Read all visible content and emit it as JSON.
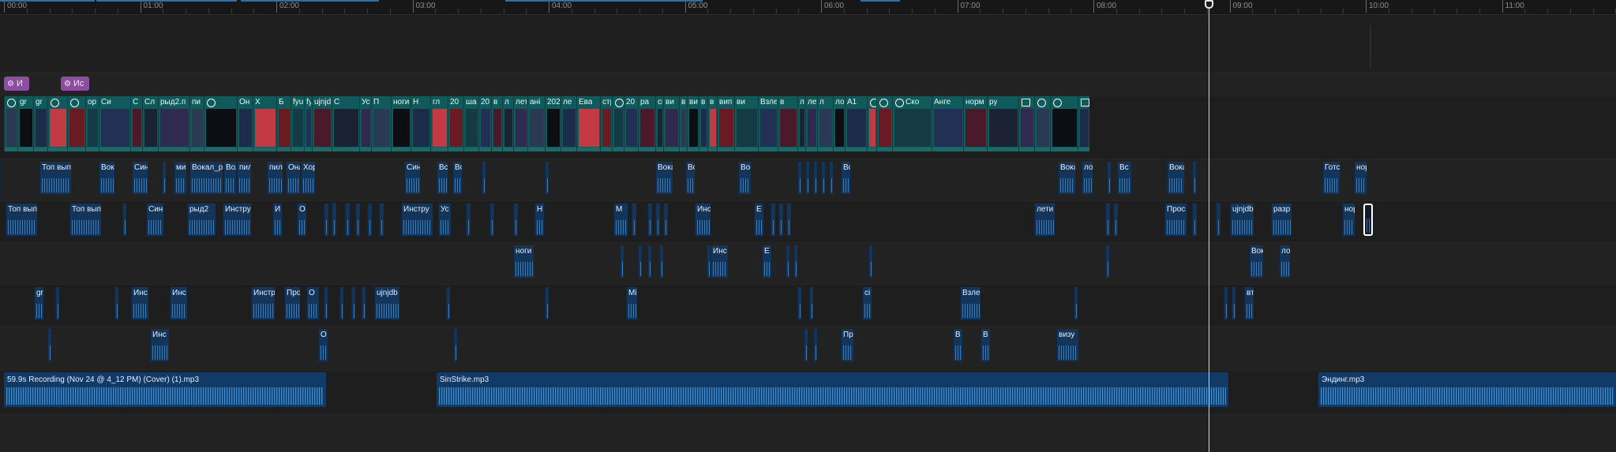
{
  "ruler": {
    "ticks": [
      "00:00",
      "01:00",
      "02:00",
      "03:00",
      "04:00",
      "05:00",
      "06:00",
      "07:00",
      "08:00",
      "09:00",
      "10:00",
      "11:00"
    ]
  },
  "playhead": {
    "time_label": ""
  },
  "tracks": {
    "effects": [
      {
        "label": "И",
        "icon": "gear-icon"
      },
      {
        "label": "Ис",
        "icon": "gear-icon"
      }
    ],
    "video": [
      {
        "label": "",
        "icon": "circle-check-icon"
      },
      {
        "label": "gr"
      },
      {
        "label": "gr"
      },
      {
        "label": "",
        "icon": "circle-check-icon"
      },
      {
        "label": "",
        "icon": "circle-check-icon"
      },
      {
        "label": "ор"
      },
      {
        "label": "Си"
      },
      {
        "label": "С"
      },
      {
        "label": "Сл"
      },
      {
        "label": "рыд2.п"
      },
      {
        "label": "пи"
      },
      {
        "label": "",
        "icon": "circle-check-icon"
      },
      {
        "label": "Он"
      },
      {
        "label": "Х"
      },
      {
        "label": "Б"
      },
      {
        "label": "fyuti"
      },
      {
        "label": "fyuti"
      },
      {
        "label": "ujnjdb"
      },
      {
        "label": "С"
      },
      {
        "label": "Ус"
      },
      {
        "label": "П"
      },
      {
        "label": "ноги"
      },
      {
        "label": "Н"
      },
      {
        "label": "гл"
      },
      {
        "label": "20"
      },
      {
        "label": "ша"
      },
      {
        "label": "20"
      },
      {
        "label": "в"
      },
      {
        "label": "л"
      },
      {
        "label": "лети"
      },
      {
        "label": "ані"
      },
      {
        "label": "202"
      },
      {
        "label": "ле"
      },
      {
        "label": "Ева"
      },
      {
        "label": "стр"
      },
      {
        "label": "",
        "icon": "circle-check-icon"
      },
      {
        "label": "20"
      },
      {
        "label": "ра"
      },
      {
        "label": "сш"
      },
      {
        "label": "ви"
      },
      {
        "label": "ві"
      },
      {
        "label": "ви"
      },
      {
        "label": "в"
      },
      {
        "label": "в"
      },
      {
        "label": "вип"
      },
      {
        "label": "ви"
      },
      {
        "label": "Взле"
      },
      {
        "label": "в"
      },
      {
        "label": "ле"
      },
      {
        "label": "ле"
      },
      {
        "label": "л"
      },
      {
        "label": "лов"
      },
      {
        "label": "А1"
      },
      {
        "label": "Ско",
        "icon": "circle-check-icon"
      },
      {
        "label": "",
        "icon": "circle-check-icon"
      },
      {
        "label": "Ско",
        "icon": "circle-check-icon"
      },
      {
        "label": "Анге"
      },
      {
        "label": "норм"
      },
      {
        "label": "ру"
      },
      {
        "label": "",
        "icon": "subtitle-icon"
      },
      {
        "label": "",
        "icon": "circle-check-icon"
      },
      {
        "label": "",
        "icon": "circle-check-icon"
      },
      {
        "label": "",
        "icon": "subtitle-icon"
      }
    ],
    "audio_1": [
      {
        "label": "Топ вып"
      },
      {
        "label": "Вока"
      },
      {
        "label": "Син"
      },
      {
        "label": "ми"
      },
      {
        "label": "Вокал_р"
      },
      {
        "label": "Вол"
      },
      {
        "label": "пил"
      },
      {
        "label": "пил"
      },
      {
        "label": "Онл"
      },
      {
        "label": "Хор"
      },
      {
        "label": "Син"
      },
      {
        "label": "Вс"
      },
      {
        "label": "Во"
      },
      {
        "label": "Вока"
      },
      {
        "label": "Вс"
      },
      {
        "label": "Вок"
      },
      {
        "label": "Вс"
      },
      {
        "label": "Вока"
      },
      {
        "label": "лов"
      },
      {
        "label": "Вс"
      },
      {
        "label": "Вока"
      },
      {
        "label": "Готс"
      },
      {
        "label": "норм"
      },
      {
        "label": "нор"
      }
    ],
    "audio_2": [
      {
        "label": "Топ вып"
      },
      {
        "label": "Топ вып"
      },
      {
        "label": "Син"
      },
      {
        "label": "рыд2"
      },
      {
        "label": "Инстру"
      },
      {
        "label": "И"
      },
      {
        "label": "О"
      },
      {
        "label": "Инстру"
      },
      {
        "label": "Ус"
      },
      {
        "label": "Н"
      },
      {
        "label": "М"
      },
      {
        "label": "Инс"
      },
      {
        "label": "Е"
      },
      {
        "label": "лети"
      },
      {
        "label": "Прос"
      },
      {
        "label": "ujnjdb"
      },
      {
        "label": "разр"
      },
      {
        "label": "нор"
      },
      {
        "label": ""
      }
    ],
    "audio_3": [
      {
        "label": "ноги"
      },
      {
        "label": "Инс"
      },
      {
        "label": "Е"
      },
      {
        "label": "Вок"
      },
      {
        "label": "лов"
      }
    ],
    "audio_4": [
      {
        "label": "gr"
      },
      {
        "label": "Инс"
      },
      {
        "label": "Инс"
      },
      {
        "label": "Инстр"
      },
      {
        "label": "Про"
      },
      {
        "label": "О"
      },
      {
        "label": "ujnjdb"
      },
      {
        "label": "Mi"
      },
      {
        "label": "сі"
      },
      {
        "label": "Взле"
      },
      {
        "label": "вт"
      }
    ],
    "audio_5": [
      {
        "label": "Инс"
      },
      {
        "label": "О"
      },
      {
        "label": "Пр"
      },
      {
        "label": "В"
      },
      {
        "label": "В"
      },
      {
        "label": "визу"
      }
    ],
    "music": [
      {
        "label": "59.9s Recording (Nov 24 @ 4_12 PM) (Cover) (1).mp3"
      },
      {
        "label": "SinStrike.mp3"
      },
      {
        "label": "Эндинг.mp3"
      }
    ]
  },
  "colors": {
    "background": "#1b1b1b",
    "video_clip": "#0f5a5a",
    "audio_clip": "#14355a",
    "waveform": "#3a8ad0",
    "effect_chip": "#8c4e9e",
    "playhead": "#d8d8d8"
  }
}
